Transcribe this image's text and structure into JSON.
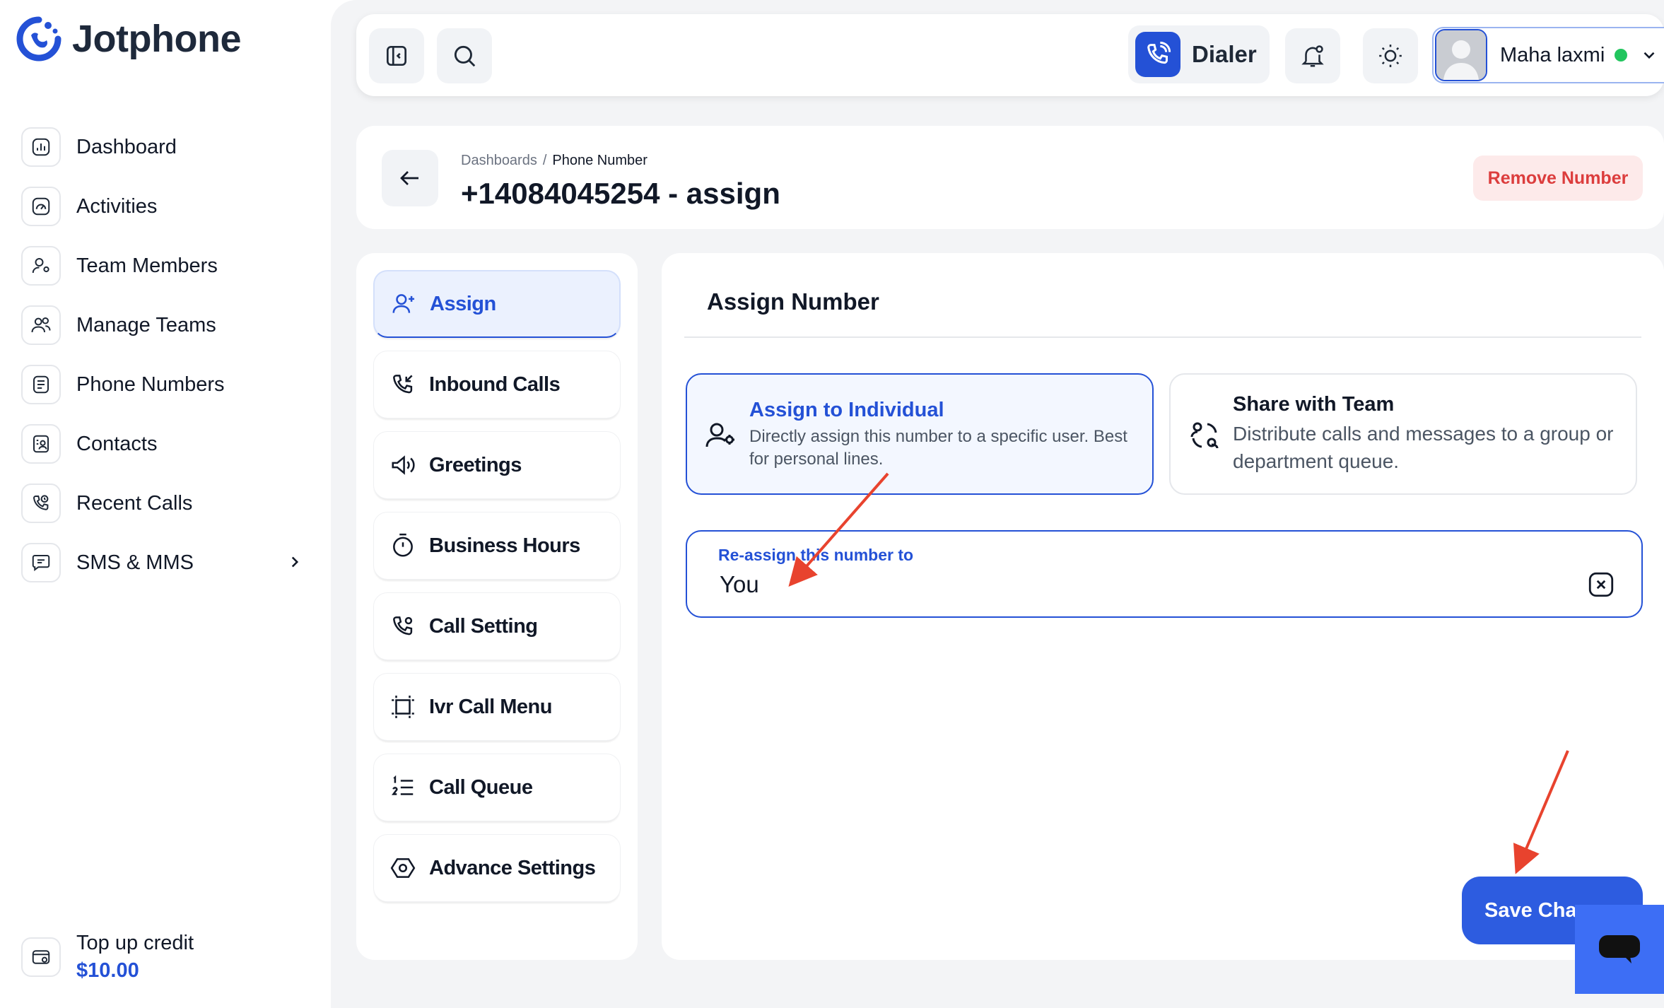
{
  "brand": {
    "name": "Jotphone"
  },
  "sidebar": {
    "items": [
      {
        "label": "Dashboard",
        "icon": "chart-icon"
      },
      {
        "label": "Activities",
        "icon": "gauge-icon"
      },
      {
        "label": "Team Members",
        "icon": "user-gear-icon"
      },
      {
        "label": "Manage Teams",
        "icon": "users-icon"
      },
      {
        "label": "Phone Numbers",
        "icon": "phone-book-icon"
      },
      {
        "label": "Contacts",
        "icon": "contact-card-icon"
      },
      {
        "label": "Recent Calls",
        "icon": "phone-history-icon"
      },
      {
        "label": "SMS & MMS",
        "icon": "message-icon"
      }
    ],
    "credit": {
      "title": "Top up credit",
      "amount": "$10.00"
    }
  },
  "topbar": {
    "dialer_label": "Dialer",
    "user_name": "Maha laxmi"
  },
  "header": {
    "breadcrumb_root": "Dashboards",
    "breadcrumb_sep": "/",
    "breadcrumb_current": "Phone Number",
    "title": "+14084045254 - assign",
    "remove_label": "Remove Number"
  },
  "settings_menu": {
    "items": [
      {
        "label": "Assign",
        "icon": "user-plus-icon",
        "active": true
      },
      {
        "label": "Inbound Calls",
        "icon": "phone-incoming-icon"
      },
      {
        "label": "Greetings",
        "icon": "megaphone-icon"
      },
      {
        "label": "Business Hours",
        "icon": "stopwatch-icon"
      },
      {
        "label": "Call Setting",
        "icon": "phone-settings-icon"
      },
      {
        "label": "Ivr Call Menu",
        "icon": "ivr-frame-icon"
      },
      {
        "label": "Call Queue",
        "icon": "numbered-list-icon"
      },
      {
        "label": "Advance Settings",
        "icon": "hexagon-settings-icon"
      }
    ]
  },
  "assign": {
    "section_title": "Assign Number",
    "individual": {
      "title": "Assign to Individual",
      "desc": "Directly assign this number to a specific user. Best for personal lines."
    },
    "team": {
      "title": "Share with Team",
      "desc": "Distribute calls and messages to a group or department queue."
    },
    "field_label": "Re-assign this number to",
    "field_value": "You",
    "save_label": "Save Changes"
  },
  "colors": {
    "accent": "#2451d6",
    "danger": "#dc3d3d",
    "annotation": "#e8432e"
  }
}
